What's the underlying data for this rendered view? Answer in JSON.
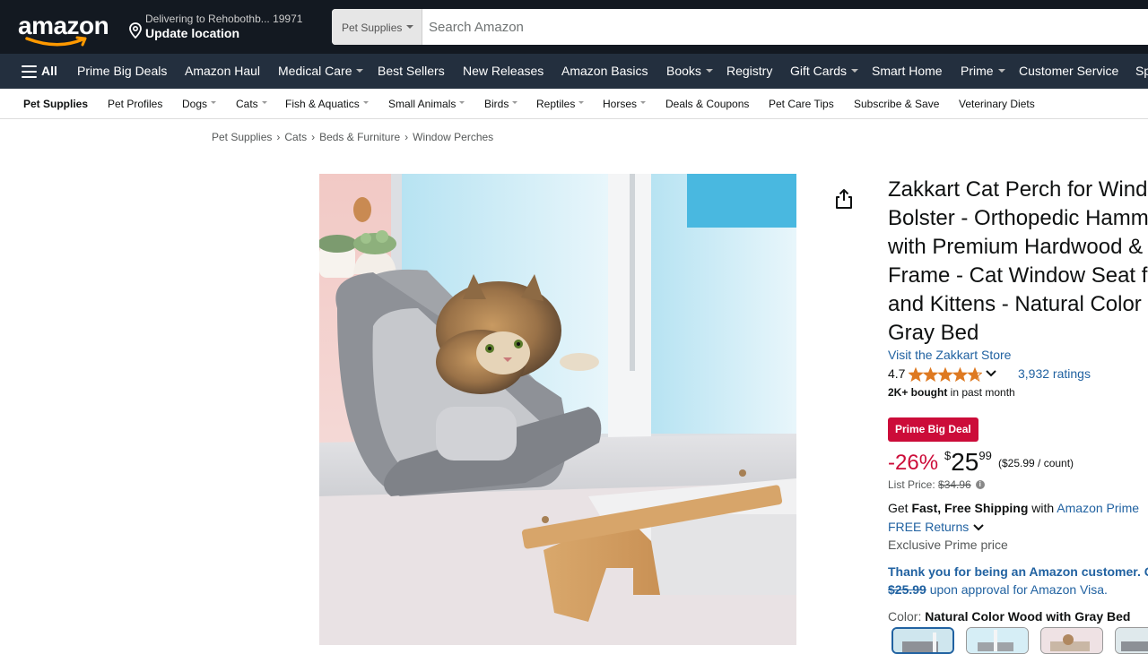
{
  "header": {
    "logo_text": "amazon",
    "deliver_line1": "Delivering to Rehobothb... 19971",
    "deliver_line2": "Update location",
    "search_category": "Pet Supplies",
    "search_placeholder": "Search Amazon"
  },
  "nav": {
    "all_label": "All",
    "items": [
      {
        "label": "Prime Big Deals"
      },
      {
        "label": "Amazon Haul"
      },
      {
        "label": "Medical Care"
      },
      {
        "label": "Best Sellers"
      },
      {
        "label": "New Releases"
      },
      {
        "label": "Amazon Basics"
      },
      {
        "label": "Books"
      },
      {
        "label": "Registry"
      },
      {
        "label": "Gift Cards"
      },
      {
        "label": "Smart Home"
      },
      {
        "label": "Prime"
      },
      {
        "label": "Customer Service"
      },
      {
        "label": "Sp"
      }
    ]
  },
  "subnav": {
    "items": [
      {
        "label": "Pet Supplies"
      },
      {
        "label": "Pet Profiles"
      },
      {
        "label": "Dogs"
      },
      {
        "label": "Cats"
      },
      {
        "label": "Fish & Aquatics"
      },
      {
        "label": "Small Animals"
      },
      {
        "label": "Birds"
      },
      {
        "label": "Reptiles"
      },
      {
        "label": "Horses"
      },
      {
        "label": "Deals & Coupons"
      },
      {
        "label": "Pet Care Tips"
      },
      {
        "label": "Subscribe & Save"
      },
      {
        "label": "Veterinary Diets"
      }
    ]
  },
  "breadcrumb": [
    "Pet Supplies",
    "Cats",
    "Beds & Furniture",
    "Window Perches"
  ],
  "breadcrumb_sep": "›",
  "product": {
    "title_lines": [
      "Zakkart Cat Perch for Wind",
      "Bolster - Orthopedic Hamm",
      "with Premium Hardwood &",
      "Frame - Cat Window Seat f",
      "and Kittens - Natural Color",
      "Gray Bed"
    ],
    "store_link": "Visit the Zakkart Store",
    "rating": "4.7",
    "rating_fraction": 0.94,
    "ratings_count": "3,932 ratings",
    "bought_bold": "2K+ bought",
    "bought_rest": " in past month",
    "deal_badge": "Prime Big Deal",
    "discount": "-26%",
    "price_symbol": "$",
    "price_whole": "25",
    "price_fraction": "99",
    "unit_price": "($25.99 / count)",
    "list_price_label": "List Price:",
    "list_price": "$34.96",
    "ship_prefix": "Get ",
    "ship_bold": "Fast, Free Shipping",
    "ship_mid": " with ",
    "ship_link": "Amazon Prime",
    "returns": "FREE Returns",
    "exclusive": "Exclusive Prime price",
    "thanks": "Thank you for being an Amazon customer. G",
    "visa_strike": "$25.99",
    "visa_rest": " upon approval for Amazon Visa.",
    "color_label": "Color: ",
    "color_value": "Natural Color Wood with Gray Bed"
  },
  "colors": {
    "header_bg": "#131921",
    "nav_bg": "#232f3e",
    "deal_red": "#cc0c39",
    "link_blue": "#2162a1",
    "star_orange": "#de7921"
  }
}
